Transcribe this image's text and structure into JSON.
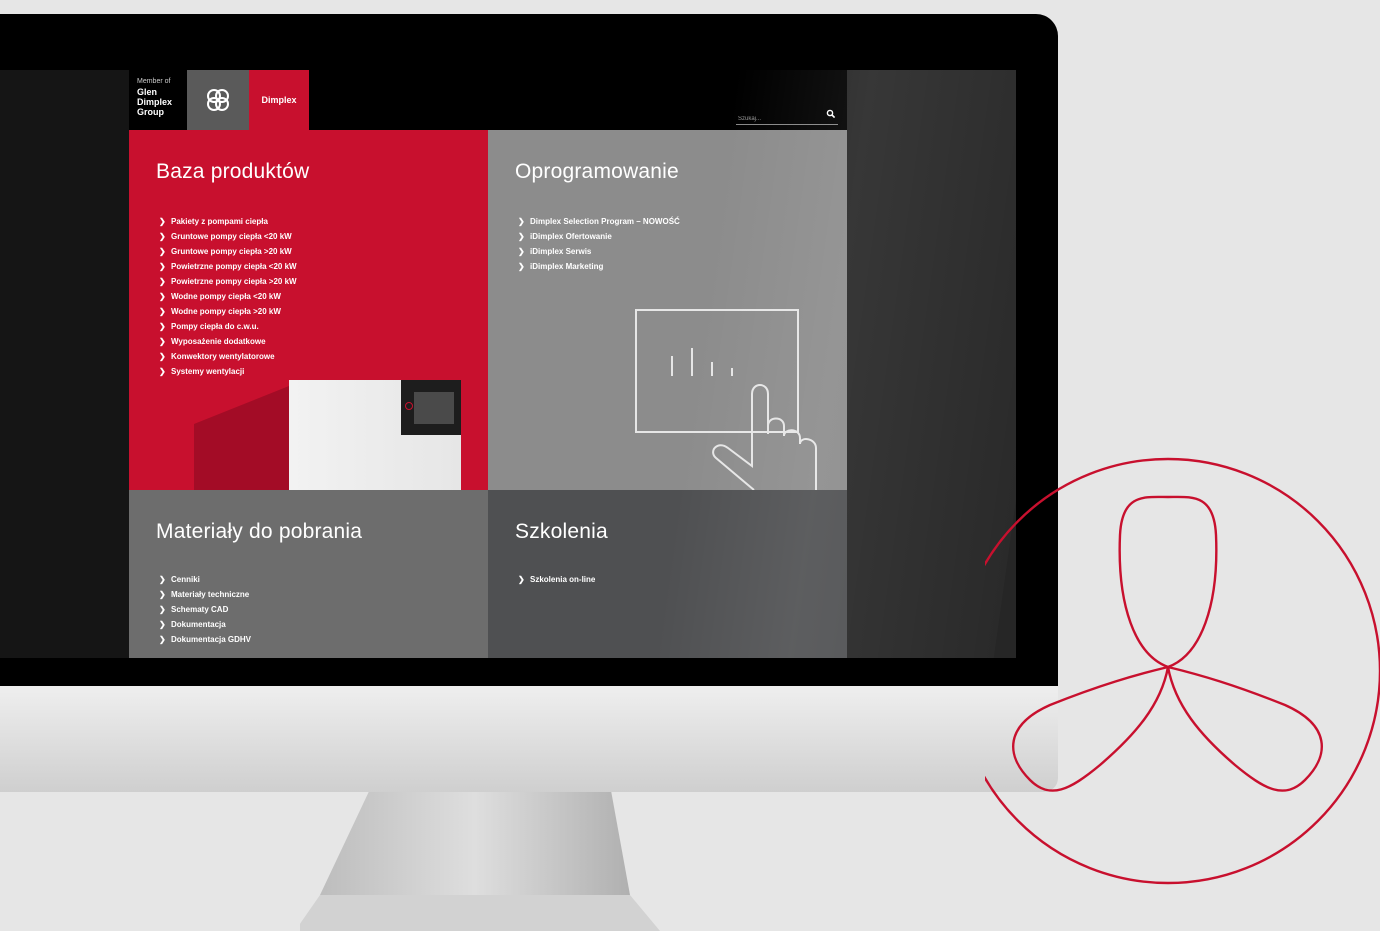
{
  "header": {
    "member_of": "Member of",
    "group_name": [
      "Glen",
      "Dimplex",
      "Group"
    ],
    "brand": "Dimplex",
    "search_placeholder": "Szukaj..."
  },
  "panels": {
    "products": {
      "title": "Baza produktów",
      "links": [
        "Pakiety z pompami ciepła",
        "Gruntowe pompy ciepła <20 kW",
        "Gruntowe pompy ciepła >20 kW",
        "Powietrzne pompy ciepła <20 kW",
        "Powietrzne pompy ciepła >20 kW",
        "Wodne pompy ciepła <20 kW",
        "Wodne pompy ciepła >20 kW",
        "Pompy ciepła do c.w.u.",
        "Wyposażenie dodatkowe",
        "Konwektory wentylatorowe",
        "Systemy wentylacji"
      ]
    },
    "software": {
      "title": "Oprogramowanie",
      "links": [
        "Dimplex Selection Program – NOWOŚĆ",
        "iDimplex Ofertowanie",
        "iDimplex Serwis",
        "iDimplex Marketing"
      ]
    },
    "downloads": {
      "title": "Materiały do pobrania",
      "links": [
        "Cenniki",
        "Materiały techniczne",
        "Schematy CAD",
        "Dokumentacja",
        "Dokumentacja GDHV"
      ]
    },
    "training": {
      "title": "Szkolenia",
      "links": [
        "Szkolenia on-line"
      ]
    }
  },
  "colors": {
    "brand_red": "#c8102e",
    "panel_gray": "#8c8c8c",
    "panel_mid": "#6d6d6d",
    "panel_dark": "#4f5052",
    "background": "#e6e6e6"
  },
  "icons": [
    "glen-dimplex-knot-icon",
    "search-icon",
    "chevron-right-icon",
    "touch-screen-icon",
    "fan-outline-icon"
  ]
}
